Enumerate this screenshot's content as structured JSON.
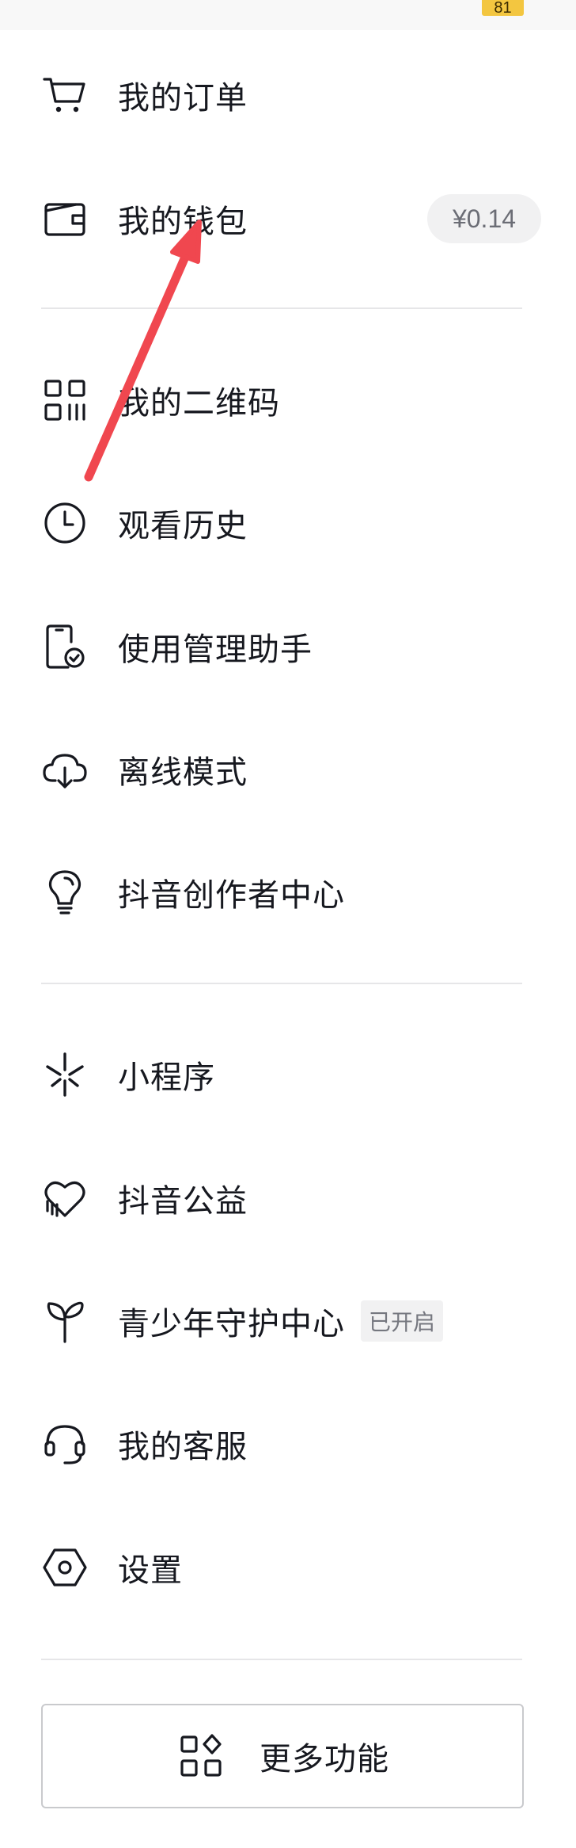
{
  "status_bar": {
    "badge": "81"
  },
  "menu": {
    "orders": {
      "label": "我的订单",
      "icon": "cart-icon"
    },
    "wallet": {
      "label": "我的钱包",
      "icon": "wallet-icon",
      "balance": "¥0.14"
    },
    "qrcode": {
      "label": "我的二维码",
      "icon": "qr-code-icon"
    },
    "history": {
      "label": "观看历史",
      "icon": "clock-icon"
    },
    "assistant": {
      "label": "使用管理助手",
      "icon": "phone-check-icon"
    },
    "offline": {
      "label": "离线模式",
      "icon": "cloud-download-icon"
    },
    "creator": {
      "label": "抖音创作者中心",
      "icon": "lightbulb-icon"
    },
    "miniapp": {
      "label": "小程序",
      "icon": "asterisk-icon"
    },
    "charity": {
      "label": "抖音公益",
      "icon": "heart-hand-icon"
    },
    "youth": {
      "label": "青少年守护中心",
      "icon": "sprout-icon",
      "status": "已开启"
    },
    "service": {
      "label": "我的客服",
      "icon": "headset-icon"
    },
    "settings": {
      "label": "设置",
      "icon": "hexagon-gear-icon"
    }
  },
  "more_functions": {
    "label": "更多功能",
    "icon": "apps-grid-icon"
  },
  "colors": {
    "badge": "#f3c640",
    "annotation_arrow": "#f0474f",
    "text": "#16181f",
    "pill_bg": "#f1f1f2"
  }
}
